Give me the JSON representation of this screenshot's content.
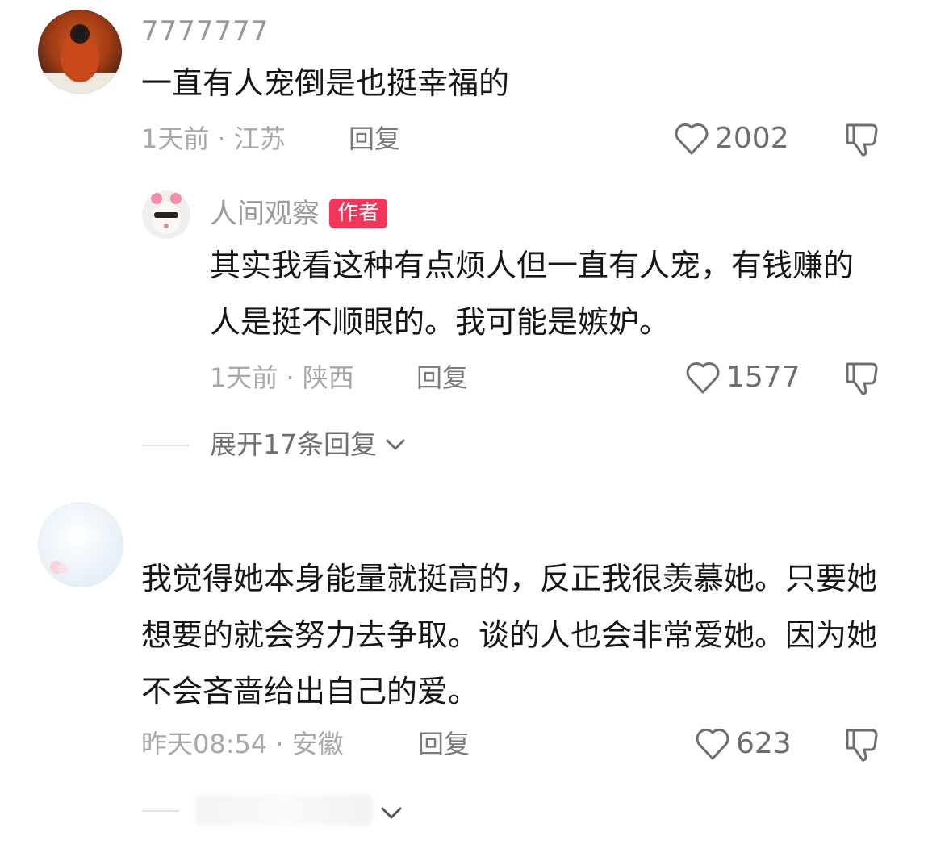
{
  "comments": [
    {
      "username": "7777777",
      "content": "一直有人宠倒是也挺幸福的",
      "meta": "1天前 · 江苏",
      "reply_label": "回复",
      "likes": "2002",
      "avatar": "photo-avatar"
    },
    {
      "username": "人间观察",
      "badge": "作者",
      "content": "其实我看这种有点烦人但一直有人宠，有钱赚的人是挺不顺眼的。我可能是嫉妒。",
      "meta": "1天前 · 陕西",
      "reply_label": "回复",
      "likes": "1577",
      "avatar": "cartoon-avatar"
    },
    {
      "username": "",
      "content": "我觉得她本身能量就挺高的，反正我很羡慕她。只要她想要的就会努力去争取。谈的人也会非常爱她。因为她不会吝啬给出自己的爱。",
      "meta": "昨天08:54 · 安徽",
      "reply_label": "回复",
      "likes": "623",
      "avatar": "light-blue-avatar"
    }
  ],
  "expand_replies_label": "展开17条回复",
  "colors": {
    "badge": "#f2355a",
    "text": "#161616",
    "secondary": "#a8a8a8"
  },
  "icons": [
    "heart-icon",
    "thumbs-down-icon",
    "chevron-down-icon"
  ]
}
